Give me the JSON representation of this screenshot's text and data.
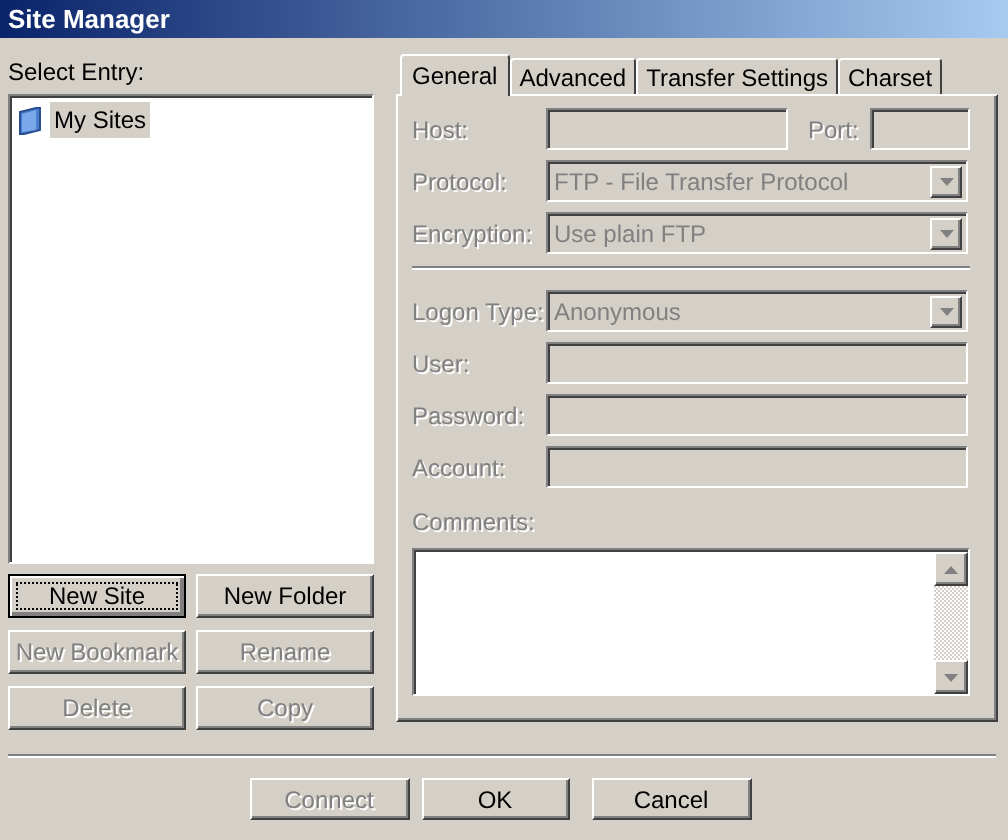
{
  "window": {
    "title": "Site Manager"
  },
  "tree": {
    "label": "Select Entry:",
    "items": [
      {
        "label": "My Sites",
        "selected": true
      }
    ]
  },
  "tree_buttons": [
    {
      "label": "New Site",
      "disabled": false,
      "focused": true
    },
    {
      "label": "New Folder",
      "disabled": false,
      "focused": false
    },
    {
      "label": "New Bookmark",
      "disabled": true,
      "focused": false
    },
    {
      "label": "Rename",
      "disabled": true,
      "focused": false
    },
    {
      "label": "Delete",
      "disabled": true,
      "focused": false
    },
    {
      "label": "Copy",
      "disabled": true,
      "focused": false
    }
  ],
  "tabs": [
    {
      "label": "General",
      "selected": true
    },
    {
      "label": "Advanced",
      "selected": false
    },
    {
      "label": "Transfer Settings",
      "selected": false
    },
    {
      "label": "Charset",
      "selected": false
    }
  ],
  "sections": [
    [
      {
        "fields": [
          {
            "label": "Host:",
            "kind": "text",
            "disabled": true
          },
          {
            "label": "Port:",
            "kind": "text",
            "disabled": true
          }
        ]
      },
      {
        "fields": [
          {
            "label": "Protocol:",
            "kind": "select",
            "value": "FTP - File Transfer Protocol",
            "disabled": true
          }
        ]
      },
      {
        "fields": [
          {
            "label": "Encryption:",
            "kind": "select",
            "value": "Use plain FTP",
            "disabled": true
          }
        ]
      }
    ],
    [
      {
        "fields": [
          {
            "label": "Logon Type:",
            "kind": "select",
            "value": "Anonymous",
            "disabled": true
          }
        ]
      },
      {
        "fields": [
          {
            "label": "User:",
            "kind": "text",
            "disabled": true
          }
        ]
      },
      {
        "fields": [
          {
            "label": "Password:",
            "kind": "text",
            "disabled": true
          }
        ]
      },
      {
        "fields": [
          {
            "label": "Account:",
            "kind": "text",
            "disabled": true
          }
        ]
      }
    ]
  ],
  "comments": {
    "label": "Comments:"
  },
  "dialog_buttons": [
    {
      "label": "Connect",
      "disabled": true
    },
    {
      "label": "OK",
      "disabled": false
    },
    {
      "label": "Cancel",
      "disabled": false
    }
  ]
}
